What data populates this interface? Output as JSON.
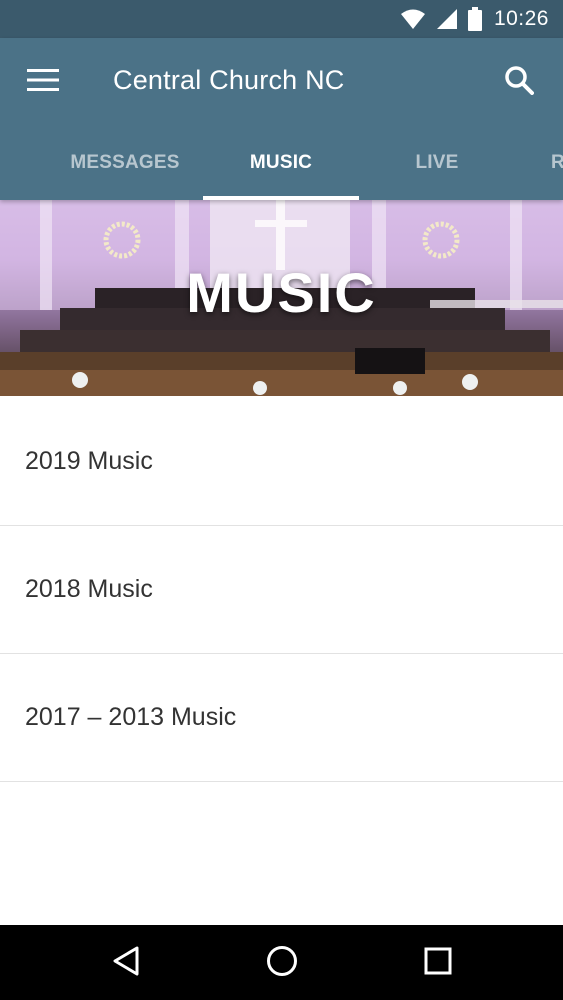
{
  "status_bar": {
    "time": "10:26",
    "icons": [
      "wifi-icon",
      "cell-signal-icon",
      "battery-icon"
    ],
    "background": "#3b5a6c"
  },
  "app_bar": {
    "title": "Central Church NC",
    "background": "#4b7287",
    "menu_icon": "hamburger-menu-icon",
    "search_icon": "search-icon"
  },
  "tabs": [
    {
      "label": "MESSAGES",
      "active": false
    },
    {
      "label": "MUSIC",
      "active": true
    },
    {
      "label": "LIVE",
      "active": false
    },
    {
      "label": "R",
      "active": false
    }
  ],
  "banner": {
    "title": "MUSIC"
  },
  "list_items": [
    {
      "label": "2019 Music"
    },
    {
      "label": "2018 Music"
    },
    {
      "label": "2017 – 2013 Music"
    }
  ],
  "nav_bar": {
    "buttons": [
      "back-icon",
      "home-icon",
      "recents-icon"
    ]
  }
}
